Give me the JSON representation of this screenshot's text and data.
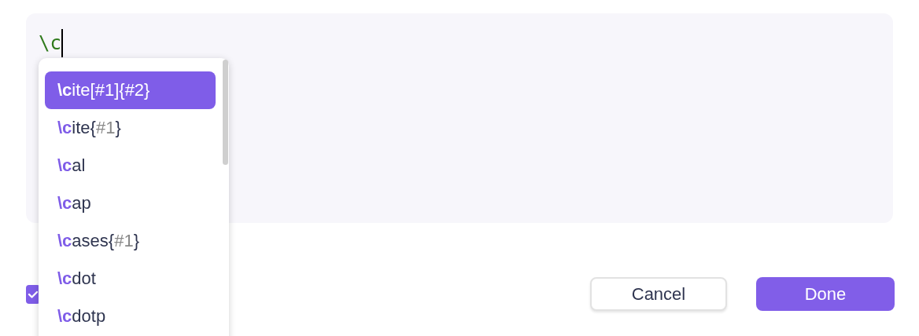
{
  "editor": {
    "value": "\\c"
  },
  "suggestions": [
    {
      "selected": true,
      "segments": [
        {
          "kind": "match",
          "text": "\\c"
        },
        {
          "kind": "plain",
          "text": "ite[#1]{#2}"
        }
      ]
    },
    {
      "selected": false,
      "segments": [
        {
          "kind": "match",
          "text": "\\c"
        },
        {
          "kind": "plain",
          "text": "ite{"
        },
        {
          "kind": "placeholder",
          "text": "#1"
        },
        {
          "kind": "plain",
          "text": "}"
        }
      ]
    },
    {
      "selected": false,
      "segments": [
        {
          "kind": "match",
          "text": "\\c"
        },
        {
          "kind": "plain",
          "text": "al"
        }
      ]
    },
    {
      "selected": false,
      "segments": [
        {
          "kind": "match",
          "text": "\\c"
        },
        {
          "kind": "plain",
          "text": "ap"
        }
      ]
    },
    {
      "selected": false,
      "segments": [
        {
          "kind": "match",
          "text": "\\c"
        },
        {
          "kind": "plain",
          "text": "ases{"
        },
        {
          "kind": "placeholder",
          "text": "#1"
        },
        {
          "kind": "plain",
          "text": "}"
        }
      ]
    },
    {
      "selected": false,
      "segments": [
        {
          "kind": "match",
          "text": "\\c"
        },
        {
          "kind": "plain",
          "text": "dot"
        }
      ]
    },
    {
      "selected": false,
      "segments": [
        {
          "kind": "match",
          "text": "\\c"
        },
        {
          "kind": "plain",
          "text": "dotp"
        }
      ]
    }
  ],
  "checkbox": {
    "checked": true
  },
  "buttons": [
    {
      "kind": "secondary",
      "label": "Cancel"
    },
    {
      "kind": "primary",
      "label": "Done"
    }
  ]
}
